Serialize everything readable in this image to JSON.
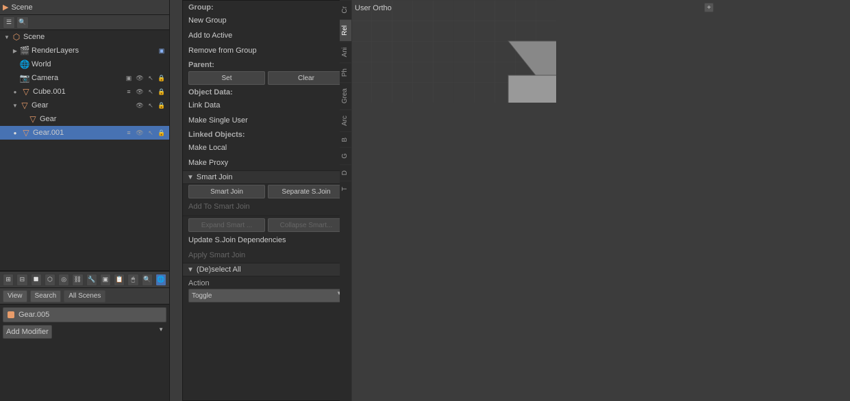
{
  "outliner": {
    "header_label": "Scene",
    "scene_name": "Scene",
    "items": [
      {
        "id": "scene",
        "label": "Scene",
        "type": "scene",
        "indent": 0,
        "expanded": true,
        "selected": false
      },
      {
        "id": "renderlayers",
        "label": "RenderLayers",
        "type": "renderlayer",
        "indent": 1,
        "expanded": false,
        "selected": false
      },
      {
        "id": "world",
        "label": "World",
        "type": "world",
        "indent": 1,
        "expanded": false,
        "selected": false
      },
      {
        "id": "camera",
        "label": "Camera",
        "type": "camera",
        "indent": 1,
        "expanded": false,
        "selected": false
      },
      {
        "id": "cube001",
        "label": "Cube.001",
        "type": "mesh",
        "indent": 1,
        "expanded": false,
        "selected": false
      },
      {
        "id": "gear",
        "label": "Gear",
        "type": "mesh",
        "indent": 1,
        "expanded": true,
        "selected": false
      },
      {
        "id": "gear-child",
        "label": "Gear",
        "type": "mesh",
        "indent": 2,
        "expanded": false,
        "selected": false
      },
      {
        "id": "gear001",
        "label": "Gear.001",
        "type": "mesh",
        "indent": 1,
        "expanded": false,
        "selected": true
      }
    ],
    "bottom_label": "Gear.005",
    "modifier_label": "Add Modifier"
  },
  "side_tabs": [
    {
      "id": "cr",
      "label": "Cr"
    },
    {
      "id": "rel",
      "label": "Rel",
      "active": true
    },
    {
      "id": "ani",
      "label": "Ani"
    },
    {
      "id": "phi",
      "label": "Ph"
    },
    {
      "id": "grea",
      "label": "Grea"
    },
    {
      "id": "arc",
      "label": "Arc"
    },
    {
      "id": "b",
      "label": "B"
    },
    {
      "id": "g",
      "label": "G"
    },
    {
      "id": "d",
      "label": "D"
    },
    {
      "id": "t",
      "label": "T"
    }
  ],
  "context_menu": {
    "sections": [
      {
        "type": "header",
        "label": "Group:"
      },
      {
        "type": "item",
        "label": "New Group",
        "disabled": false
      },
      {
        "type": "item",
        "label": "Add to Active",
        "disabled": false
      },
      {
        "type": "item",
        "label": "Remove from Group",
        "disabled": false
      },
      {
        "type": "header",
        "label": "Parent:"
      },
      {
        "type": "dual_btn",
        "btn1": "Set",
        "btn2": "Clear"
      },
      {
        "type": "header",
        "label": "Object Data:"
      },
      {
        "type": "item",
        "label": "Link Data",
        "disabled": false
      },
      {
        "type": "item",
        "label": "Make Single User",
        "disabled": false
      },
      {
        "type": "header",
        "label": "Linked Objects:"
      },
      {
        "type": "item",
        "label": "Make Local",
        "disabled": false
      },
      {
        "type": "item",
        "label": "Make Proxy",
        "disabled": false
      },
      {
        "type": "section_toggle",
        "label": "Smart Join",
        "expanded": true
      },
      {
        "type": "dual_btn",
        "btn1": "Smart Join",
        "btn2": "Separate S.Join"
      },
      {
        "type": "item",
        "label": "Add To Smart Join",
        "disabled": true
      },
      {
        "type": "divider"
      },
      {
        "type": "dual_btn_disabled",
        "btn1": "Expand Smart ...",
        "btn2": "Collapse Smart..."
      },
      {
        "type": "item",
        "label": "Update S.Join Dependencies",
        "disabled": false
      },
      {
        "type": "item",
        "label": "Apply Smart Join",
        "disabled": true
      },
      {
        "type": "section_toggle",
        "label": "(De)select All",
        "expanded": true
      },
      {
        "type": "action_section",
        "action_label": "Action",
        "action_value": "Toggle"
      }
    ]
  },
  "viewport": {
    "label": "User Ortho",
    "add_btn": "+"
  }
}
